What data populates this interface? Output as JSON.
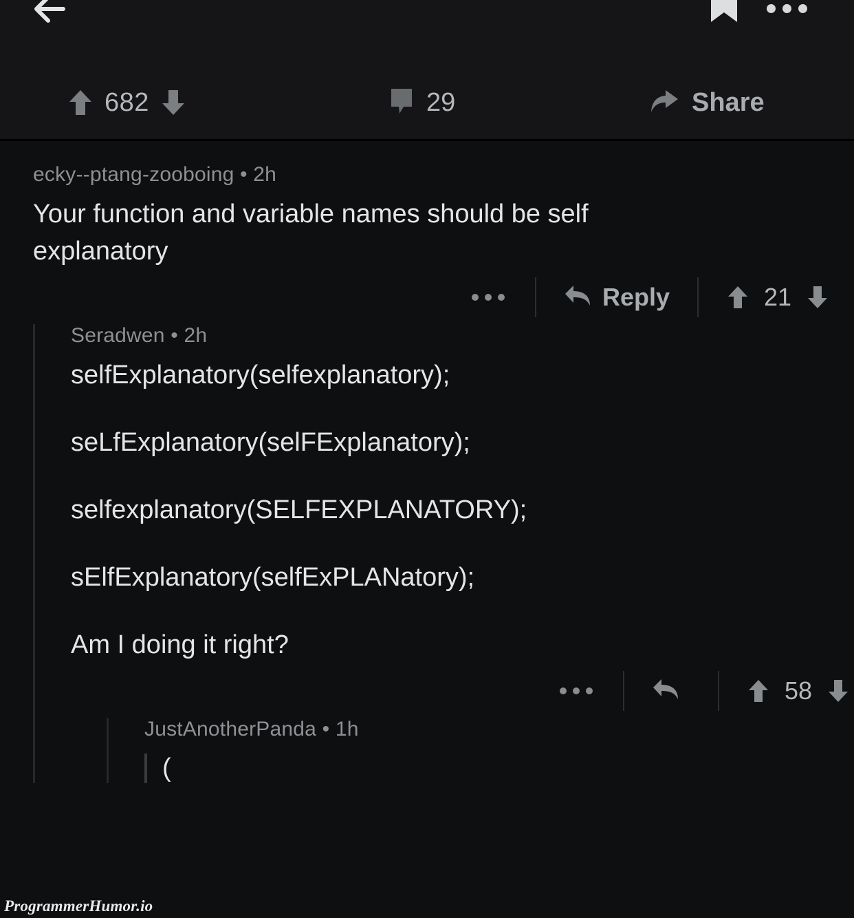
{
  "theme": {
    "page_bg": "#0e0f11",
    "header_bg": "#151517",
    "text_primary": "#e3e5e7",
    "text_muted": "#8e9194",
    "icon_gray": "#8a8d90",
    "thread_line": "#26282b"
  },
  "header": {
    "back_icon": "back-arrow-icon",
    "bookmark_icon": "bookmark-icon",
    "overflow_icon": "more-options-icon",
    "post_score": "682",
    "upvote_icon": "upvote-arrow-icon",
    "downvote_icon": "downvote-arrow-icon",
    "comment_count": "29",
    "comment_icon": "comment-bubble-icon",
    "share_label": "Share",
    "share_icon": "share-arrow-icon"
  },
  "comments": [
    {
      "id": "comment-root",
      "author": "ecky--ptang-zooboing",
      "separator": "•",
      "age": "2h",
      "meta": "ecky--ptang-zooboing • 2h",
      "paragraphs": [
        "Your function and variable names should be self explanatory"
      ],
      "actions": {
        "overflow_icon": "more-options-icon",
        "reply_icon": "reply-arrow-icon",
        "reply_label": "Reply",
        "upvote_icon": "upvote-arrow-icon",
        "score": "21",
        "downvote_icon": "downvote-arrow-icon"
      }
    },
    {
      "id": "comment-reply-1",
      "author": "Seradwen",
      "separator": "•",
      "age": "2h",
      "meta": "Seradwen • 2h",
      "paragraphs": [
        "selfExplanatory(selfexplanatory);",
        "seLfExplanatory(selFExplanatory);",
        "selfexplanatory(SELFEXPLANATORY);",
        "sElfExplanatory(selfExPLANatory);",
        "Am I doing it right?"
      ],
      "actions": {
        "overflow_icon": "more-options-icon",
        "reply_icon": "reply-arrow-icon",
        "reply_label": "",
        "upvote_icon": "upvote-arrow-icon",
        "score": "58",
        "downvote_icon": "downvote-arrow-icon"
      }
    },
    {
      "id": "comment-reply-2",
      "author": "JustAnotherPanda",
      "separator": "•",
      "age": "1h",
      "meta": "JustAnotherPanda • 1h",
      "quote": "(",
      "paragraphs": []
    }
  ],
  "watermark": "ProgrammerHumor.io"
}
